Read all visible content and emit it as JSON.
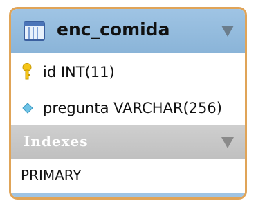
{
  "table": {
    "name": "enc_comida",
    "icon": "table-icon",
    "columns": [
      {
        "text": "id INT(11)",
        "icon": "primary-key-icon"
      },
      {
        "text": "pregunta VARCHAR(256)",
        "icon": "column-diamond-icon"
      }
    ]
  },
  "indexes": {
    "title": "Indexes",
    "items": [
      "PRIMARY"
    ]
  },
  "colors": {
    "border": "#e0a458",
    "header": "#9fc4e4",
    "indexes_header": "#c4c4c4",
    "key": "#f5c518",
    "diamond": "#6fc3e6"
  }
}
